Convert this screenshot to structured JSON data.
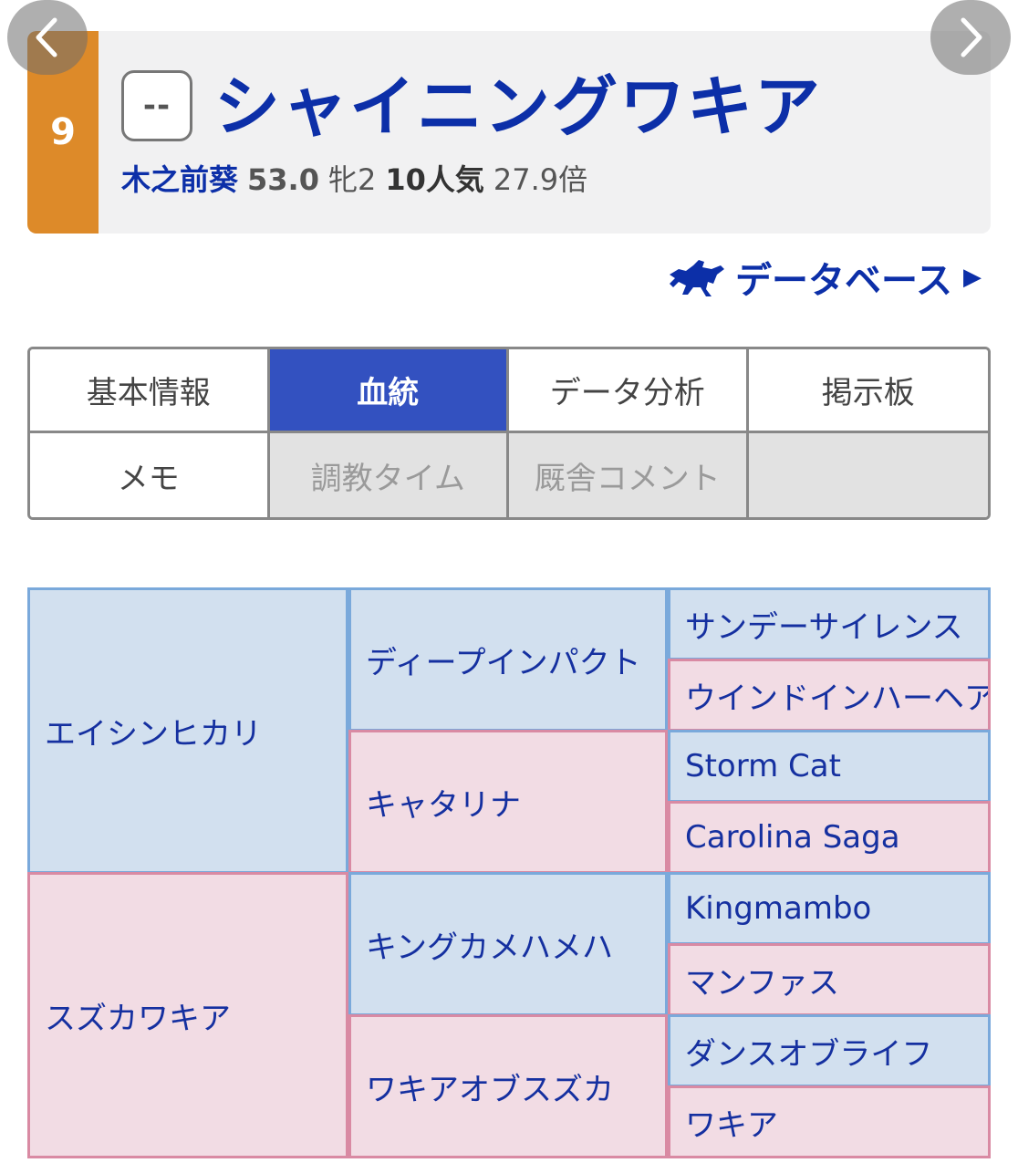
{
  "header": {
    "post_number": "9",
    "mark": "--",
    "horse_name": "シャイニングワキア",
    "jockey": "木之前葵",
    "weight": "53.0",
    "sex_age": "牝2",
    "popularity": "10人気",
    "odds": "27.9倍"
  },
  "nav": {
    "prev_icon": "chevron-left-icon",
    "next_icon": "chevron-right-icon"
  },
  "database_link": {
    "label": "データベース",
    "icon": "horse-rider-icon"
  },
  "tabs": [
    {
      "label": "基本情報",
      "state": "normal"
    },
    {
      "label": "血統",
      "state": "active"
    },
    {
      "label": "データ分析",
      "state": "normal"
    },
    {
      "label": "掲示板",
      "state": "normal"
    },
    {
      "label": "メモ",
      "state": "normal"
    },
    {
      "label": "調教タイム",
      "state": "disabled"
    },
    {
      "label": "厩舎コメント",
      "state": "disabled"
    },
    {
      "label": "",
      "state": "disabled"
    }
  ],
  "pedigree": {
    "sire": "エイシンヒカリ",
    "dam": "スズカワキア",
    "sire_sire": "ディープインパクト",
    "sire_dam": "キャタリナ",
    "dam_sire": "キングカメハメハ",
    "dam_dam": "ワキアオブスズカ",
    "gen3": [
      "サンデーサイレンス",
      "ウインドインハーヘア",
      "Storm Cat",
      "Carolina Saga",
      "Kingmambo",
      "マンファス",
      "ダンスオブライフ",
      "ワキア"
    ]
  },
  "colors": {
    "post_orange": "#dd8a29",
    "brand_blue": "#0c2fa8",
    "tab_active": "#3351c0",
    "male_bg": "#d2e0ef",
    "female_bg": "#f2dce4"
  }
}
